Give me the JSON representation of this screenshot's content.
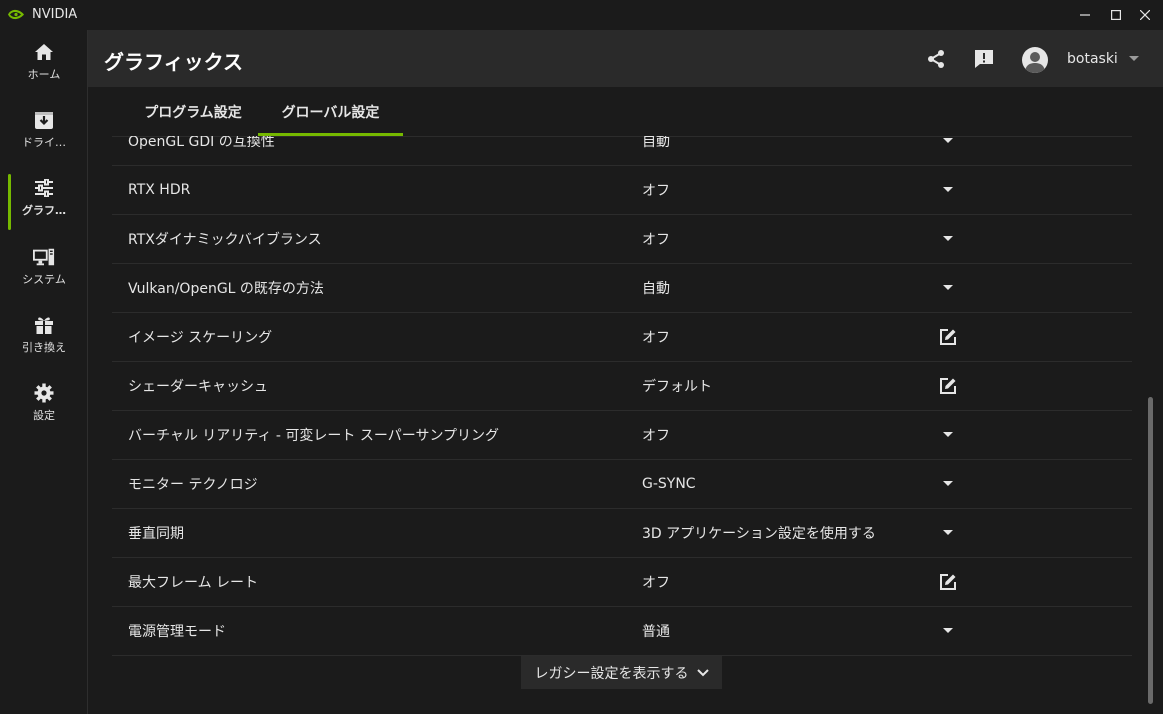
{
  "window": {
    "title": "NVIDIA",
    "minimize_icon": "minimize-icon",
    "maximize_icon": "maximize-icon",
    "close_icon": "close-icon"
  },
  "sidebar": {
    "items": [
      {
        "label": "ホーム",
        "icon": "home-icon"
      },
      {
        "label": "ドライ…",
        "icon": "driver-download-icon"
      },
      {
        "label": "グラフ…",
        "icon": "sliders-icon",
        "active": true
      },
      {
        "label": "システム",
        "icon": "system-monitor-icon"
      },
      {
        "label": "引き換え",
        "icon": "gift-icon"
      },
      {
        "label": "設定",
        "icon": "gear-icon"
      }
    ]
  },
  "header": {
    "title": "グラフィックス",
    "share_icon": "share-icon",
    "feedback_icon": "feedback-icon",
    "username": "botaski"
  },
  "tabs": [
    {
      "label": "プログラム設定",
      "active": false
    },
    {
      "label": "グローバル設定",
      "active": true
    }
  ],
  "settings": [
    {
      "label": "OpenGL GDI の互換性",
      "value": "自動",
      "control": "dropdown"
    },
    {
      "label": "RTX HDR",
      "value": "オフ",
      "control": "dropdown"
    },
    {
      "label": "RTXダイナミックバイブランス",
      "value": "オフ",
      "control": "dropdown"
    },
    {
      "label": "Vulkan/OpenGL の既存の方法",
      "value": "自動",
      "control": "dropdown"
    },
    {
      "label": "イメージ スケーリング",
      "value": "オフ",
      "control": "edit"
    },
    {
      "label": "シェーダーキャッシュ",
      "value": "デフォルト",
      "control": "edit"
    },
    {
      "label": "バーチャル リアリティ - 可変レート スーパーサンプリング",
      "value": "オフ",
      "control": "dropdown"
    },
    {
      "label": "モニター テクノロジ",
      "value": "G-SYNC",
      "control": "dropdown"
    },
    {
      "label": "垂直同期",
      "value": "3D アプリケーション設定を使用する",
      "control": "dropdown"
    },
    {
      "label": "最大フレーム レート",
      "value": "オフ",
      "control": "edit"
    },
    {
      "label": "電源管理モード",
      "value": "普通",
      "control": "dropdown"
    }
  ],
  "legacy_button": {
    "label": "レガシー設定を表示する"
  },
  "colors": {
    "accent": "#76b900",
    "background": "#1b1b1b",
    "header": "#2a2a2a"
  }
}
